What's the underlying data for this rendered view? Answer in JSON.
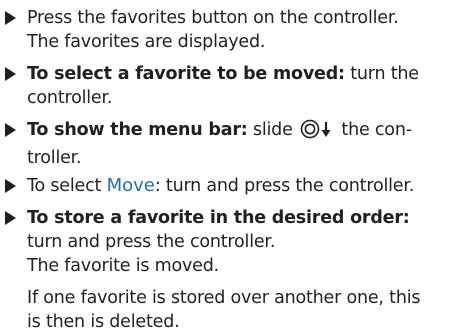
{
  "steps": [
    {
      "lead": "",
      "text": "Press the favorites button on the controller.",
      "result": "The favorites are displayed."
    },
    {
      "lead": "To select a favorite to be moved:",
      "text": "turn the controller."
    },
    {
      "lead": "To show the menu bar:",
      "text_before": "slide",
      "text_after": "the con-",
      "text_line2": "troller.",
      "icon": "controller-slide-down-icon"
    },
    {
      "text_before": "To select",
      "menu_term": "Move",
      "text_after": ": turn and press the controller."
    },
    {
      "lead": "To store a favorite in the desired order:",
      "text": "turn and press the controller.",
      "result": "The favorite is moved."
    }
  ],
  "note": {
    "line1": "If one favorite is stored over another one, this",
    "line2": "is then is deleted."
  },
  "colors": {
    "text": "#231f20",
    "menu_term": "#1b72b5"
  }
}
